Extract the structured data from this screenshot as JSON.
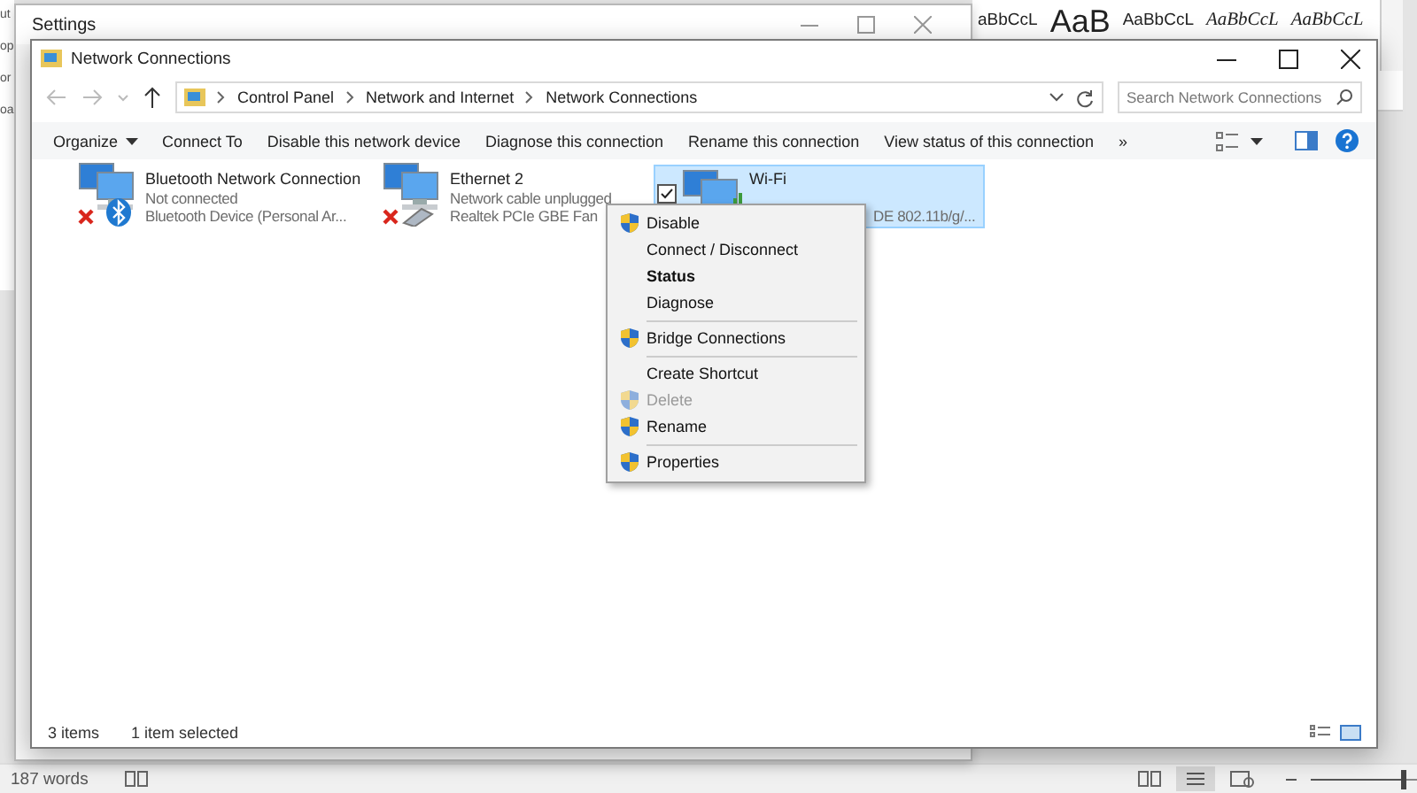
{
  "background_app": {
    "edge_fragments": [
      "ut",
      "op",
      "or",
      "oa"
    ],
    "style_gallery": [
      {
        "sample": "aBbCcL",
        "kind": "plain"
      },
      {
        "sample": "AaB",
        "kind": "large"
      },
      {
        "sample": "AaBbCcL",
        "kind": "caps"
      },
      {
        "sample": "AaBbCcL",
        "kind": "italic"
      },
      {
        "sample": "AaBbCcL",
        "kind": "italic"
      }
    ],
    "status_bar": {
      "word_count": "187 words",
      "zoom_slider": {
        "level": 0.9
      }
    }
  },
  "settings_window": {
    "title": "Settings"
  },
  "window": {
    "title": "Network Connections",
    "address_bar": {
      "path": [
        "Control Panel",
        "Network and Internet",
        "Network Connections"
      ]
    },
    "search": {
      "placeholder": "Search Network Connections"
    },
    "toolbar": [
      {
        "label": "Organize",
        "dropdown": true
      },
      {
        "label": "Connect To",
        "dropdown": false
      },
      {
        "label": "Disable this network device",
        "dropdown": false
      },
      {
        "label": "Diagnose this connection",
        "dropdown": false
      },
      {
        "label": "Rename this connection",
        "dropdown": false
      },
      {
        "label": "View status of this connection",
        "dropdown": false
      },
      {
        "label": "»",
        "dropdown": false
      }
    ],
    "adapters": [
      {
        "name": "Bluetooth Network Connection",
        "status": "Not connected",
        "device": "Bluetooth Device (Personal Ar...",
        "kind": "bluetooth",
        "connected": false,
        "selected": false
      },
      {
        "name": "Ethernet 2",
        "status": "Network cable unplugged",
        "device": "Realtek PCIe GBE Fan",
        "kind": "ethernet",
        "connected": false,
        "selected": false
      },
      {
        "name": "Wi-Fi",
        "device": "DE 802.11b/g/...",
        "kind": "wifi",
        "connected": true,
        "selected": true
      }
    ],
    "status_bar": {
      "count": "3 items",
      "selection": "1 item selected"
    }
  },
  "context_menu": [
    {
      "kind": "item",
      "label": "Disable",
      "shield": true,
      "bold": false,
      "disabled": false
    },
    {
      "kind": "item",
      "label": "Connect / Disconnect",
      "shield": false,
      "bold": false,
      "disabled": false
    },
    {
      "kind": "item",
      "label": "Status",
      "shield": false,
      "bold": true,
      "disabled": false
    },
    {
      "kind": "item",
      "label": "Diagnose",
      "shield": false,
      "bold": false,
      "disabled": false
    },
    {
      "kind": "separator"
    },
    {
      "kind": "item",
      "label": "Bridge Connections",
      "shield": true,
      "bold": false,
      "disabled": false
    },
    {
      "kind": "separator"
    },
    {
      "kind": "item",
      "label": "Create Shortcut",
      "shield": false,
      "bold": false,
      "disabled": false
    },
    {
      "kind": "item",
      "label": "Delete",
      "shield": true,
      "bold": false,
      "disabled": true
    },
    {
      "kind": "item",
      "label": "Rename",
      "shield": true,
      "bold": false,
      "disabled": false
    },
    {
      "kind": "separator"
    },
    {
      "kind": "item",
      "label": "Properties",
      "shield": true,
      "bold": false,
      "disabled": false
    }
  ]
}
